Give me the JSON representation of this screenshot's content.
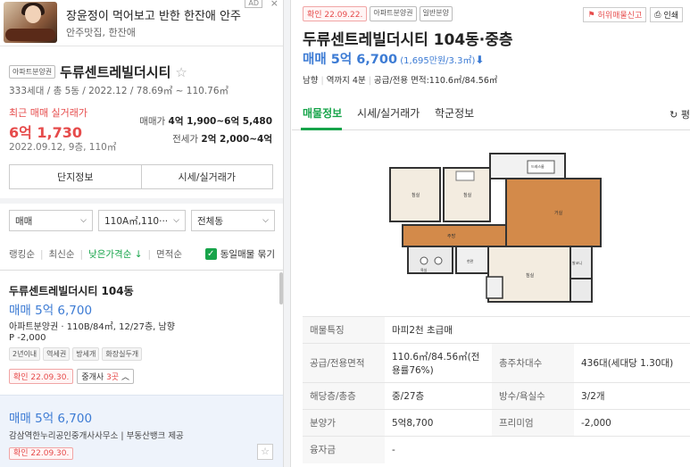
{
  "ad": {
    "title": "장윤정이 먹어보고 반한 한잔애 안주",
    "subtitle": "안주맛집, 한잔애",
    "badge": "AD",
    "close": "×"
  },
  "complex": {
    "type_tag": "아파트분양권",
    "name": "두류센트레빌더시티",
    "info": "333세대 / 총 5동 / 2022.12 / 78.69㎡ ~ 110.76㎡",
    "recent_label": "최근 매매 실거래가",
    "recent_price": "6억 1,730",
    "recent_date": "2022.09.12, 9층, 110㎡",
    "sale_range_label": "매매가",
    "sale_range_value": "4억 1,900~6억 5,480",
    "jeonse_range_label": "전세가",
    "jeonse_range_value": "2억 2,000~4억",
    "btn_info": "단지정보",
    "btn_price": "시세/실거래가"
  },
  "filters": {
    "trade": "매매",
    "area": "110A㎡,110···",
    "dong": "전체동"
  },
  "sort": {
    "items": [
      "랭킹순",
      "최신순"
    ],
    "active": "낮은가격순 ↓",
    "area": "면적순",
    "same_listing": "동일매물 묶기"
  },
  "listing1": {
    "title": "두류센트레빌더시티 104동",
    "price": "매매 5억 6,700",
    "info": "아파트분양권 · 110B/84㎡, 12/27층, 남향",
    "diff": "P -2,000",
    "tags": [
      "2년이내",
      "역세권",
      "방세개",
      "화장실두개"
    ],
    "confirm": "확인 22.09.30.",
    "broker_prefix": "중개사 ",
    "broker_count": "3곳",
    "broker_suffix": " ︿"
  },
  "listing2": {
    "price": "매매 5억 6,700",
    "agent": "감삼역한누리공인중개사사무소 | 부동산뱅크 제공",
    "confirm": "확인 22.09.30.",
    "fav": "☆"
  },
  "detail": {
    "tags": [
      "확인 22.09.22.",
      "아파트분양권",
      "일반분양"
    ],
    "report": "허위매물신고",
    "print": "인쇄",
    "title": "두류센트레빌더시티 104동·중층",
    "price": "매매 5억 6,700",
    "price_unit": " (1,695만원/3.3㎡)",
    "price_arrow": "⬇",
    "meta": [
      "남향",
      "역까지 4분",
      "공급/전용 면적:110.6㎡/84.56㎡"
    ],
    "tabs": [
      "매물정보",
      "시세/실거래가",
      "학군정보"
    ],
    "refresh": "↻ 평",
    "rooms": {
      "r1": "침실",
      "r2": "침실",
      "r3": "드레스룸",
      "r4": "거실",
      "r5": "주방",
      "r6": "침실",
      "r7": "욕실",
      "r8": "현관",
      "r9": "발코니"
    },
    "spec": [
      {
        "k": "매물특징",
        "v": "마피2천 초급매"
      },
      {
        "k": "공급/전용면적",
        "v": "110.6㎡/84.56㎡(전용률76%)",
        "k2": "총주차대수",
        "v2": "436대(세대당 1.30대)"
      },
      {
        "k": "해당층/총층",
        "v": "중/27층",
        "k2": "방수/욕실수",
        "v2": "3/2개"
      },
      {
        "k": "분양가",
        "v": "5억8,700",
        "k2": "프리미엄",
        "v2": "-2,000"
      },
      {
        "k": "융자금",
        "v": "-"
      }
    ]
  }
}
